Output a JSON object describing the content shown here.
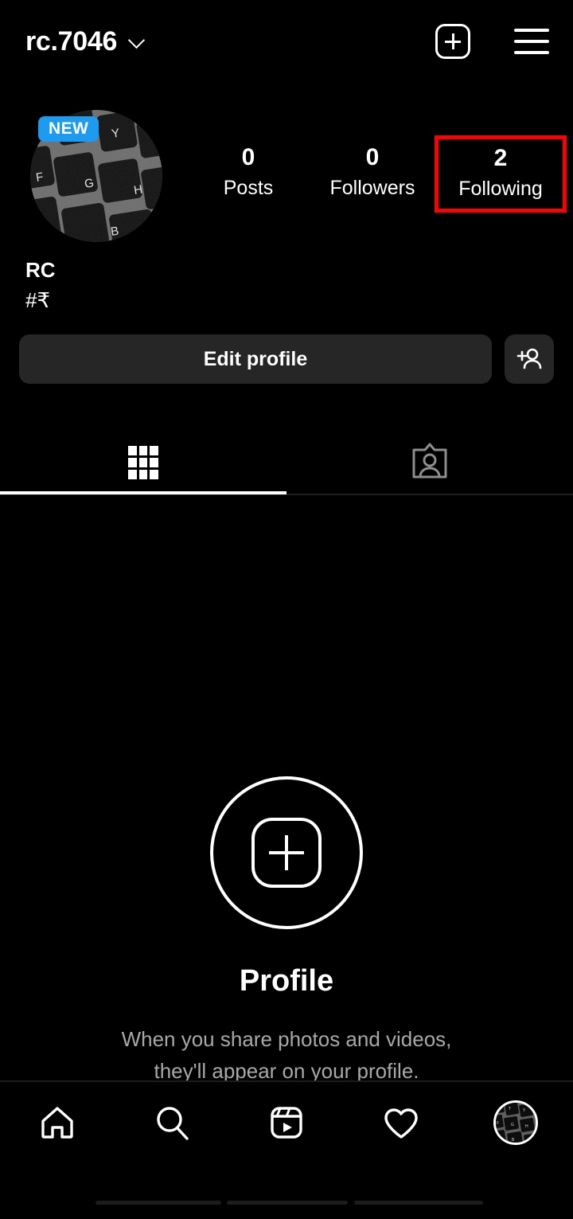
{
  "header": {
    "username": "rc.7046",
    "chevron_icon": "chevron-down-icon",
    "new_post_icon": "plus-square-icon",
    "menu_icon": "hamburger-menu-icon"
  },
  "profile": {
    "avatar_alt": "keyboard-closeup-avatar",
    "avatar_keys": [
      "T",
      "Y",
      "F",
      "G",
      "H",
      "B"
    ],
    "new_badge": "NEW",
    "new_badge_color": "#1d9bf0",
    "display_name": "RC",
    "bio": "#₹"
  },
  "stats": [
    {
      "value": "0",
      "label": "Posts",
      "highlighted": false
    },
    {
      "value": "0",
      "label": "Followers",
      "highlighted": false
    },
    {
      "value": "2",
      "label": "Following",
      "highlighted": true
    }
  ],
  "annotation": {
    "box_color": "#ff0000",
    "target": "Following"
  },
  "actions": {
    "edit_profile_label": "Edit profile",
    "add_person_icon": "add-person-icon"
  },
  "tabs": [
    {
      "name": "grid",
      "icon": "grid-icon",
      "active": true
    },
    {
      "name": "tagged",
      "icon": "person-card-icon",
      "active": false
    }
  ],
  "empty_state": {
    "icon": "plus-in-circle-icon",
    "title": "Profile",
    "subtitle": "When you share photos and videos, they'll appear on your profile."
  },
  "bottom_nav": [
    {
      "name": "home",
      "icon": "home-icon",
      "active": false
    },
    {
      "name": "search",
      "icon": "search-icon",
      "active": false
    },
    {
      "name": "reels",
      "icon": "reels-icon",
      "active": false
    },
    {
      "name": "activity",
      "icon": "heart-icon",
      "active": false
    },
    {
      "name": "profile",
      "icon": "profile-avatar-icon",
      "active": true
    }
  ]
}
